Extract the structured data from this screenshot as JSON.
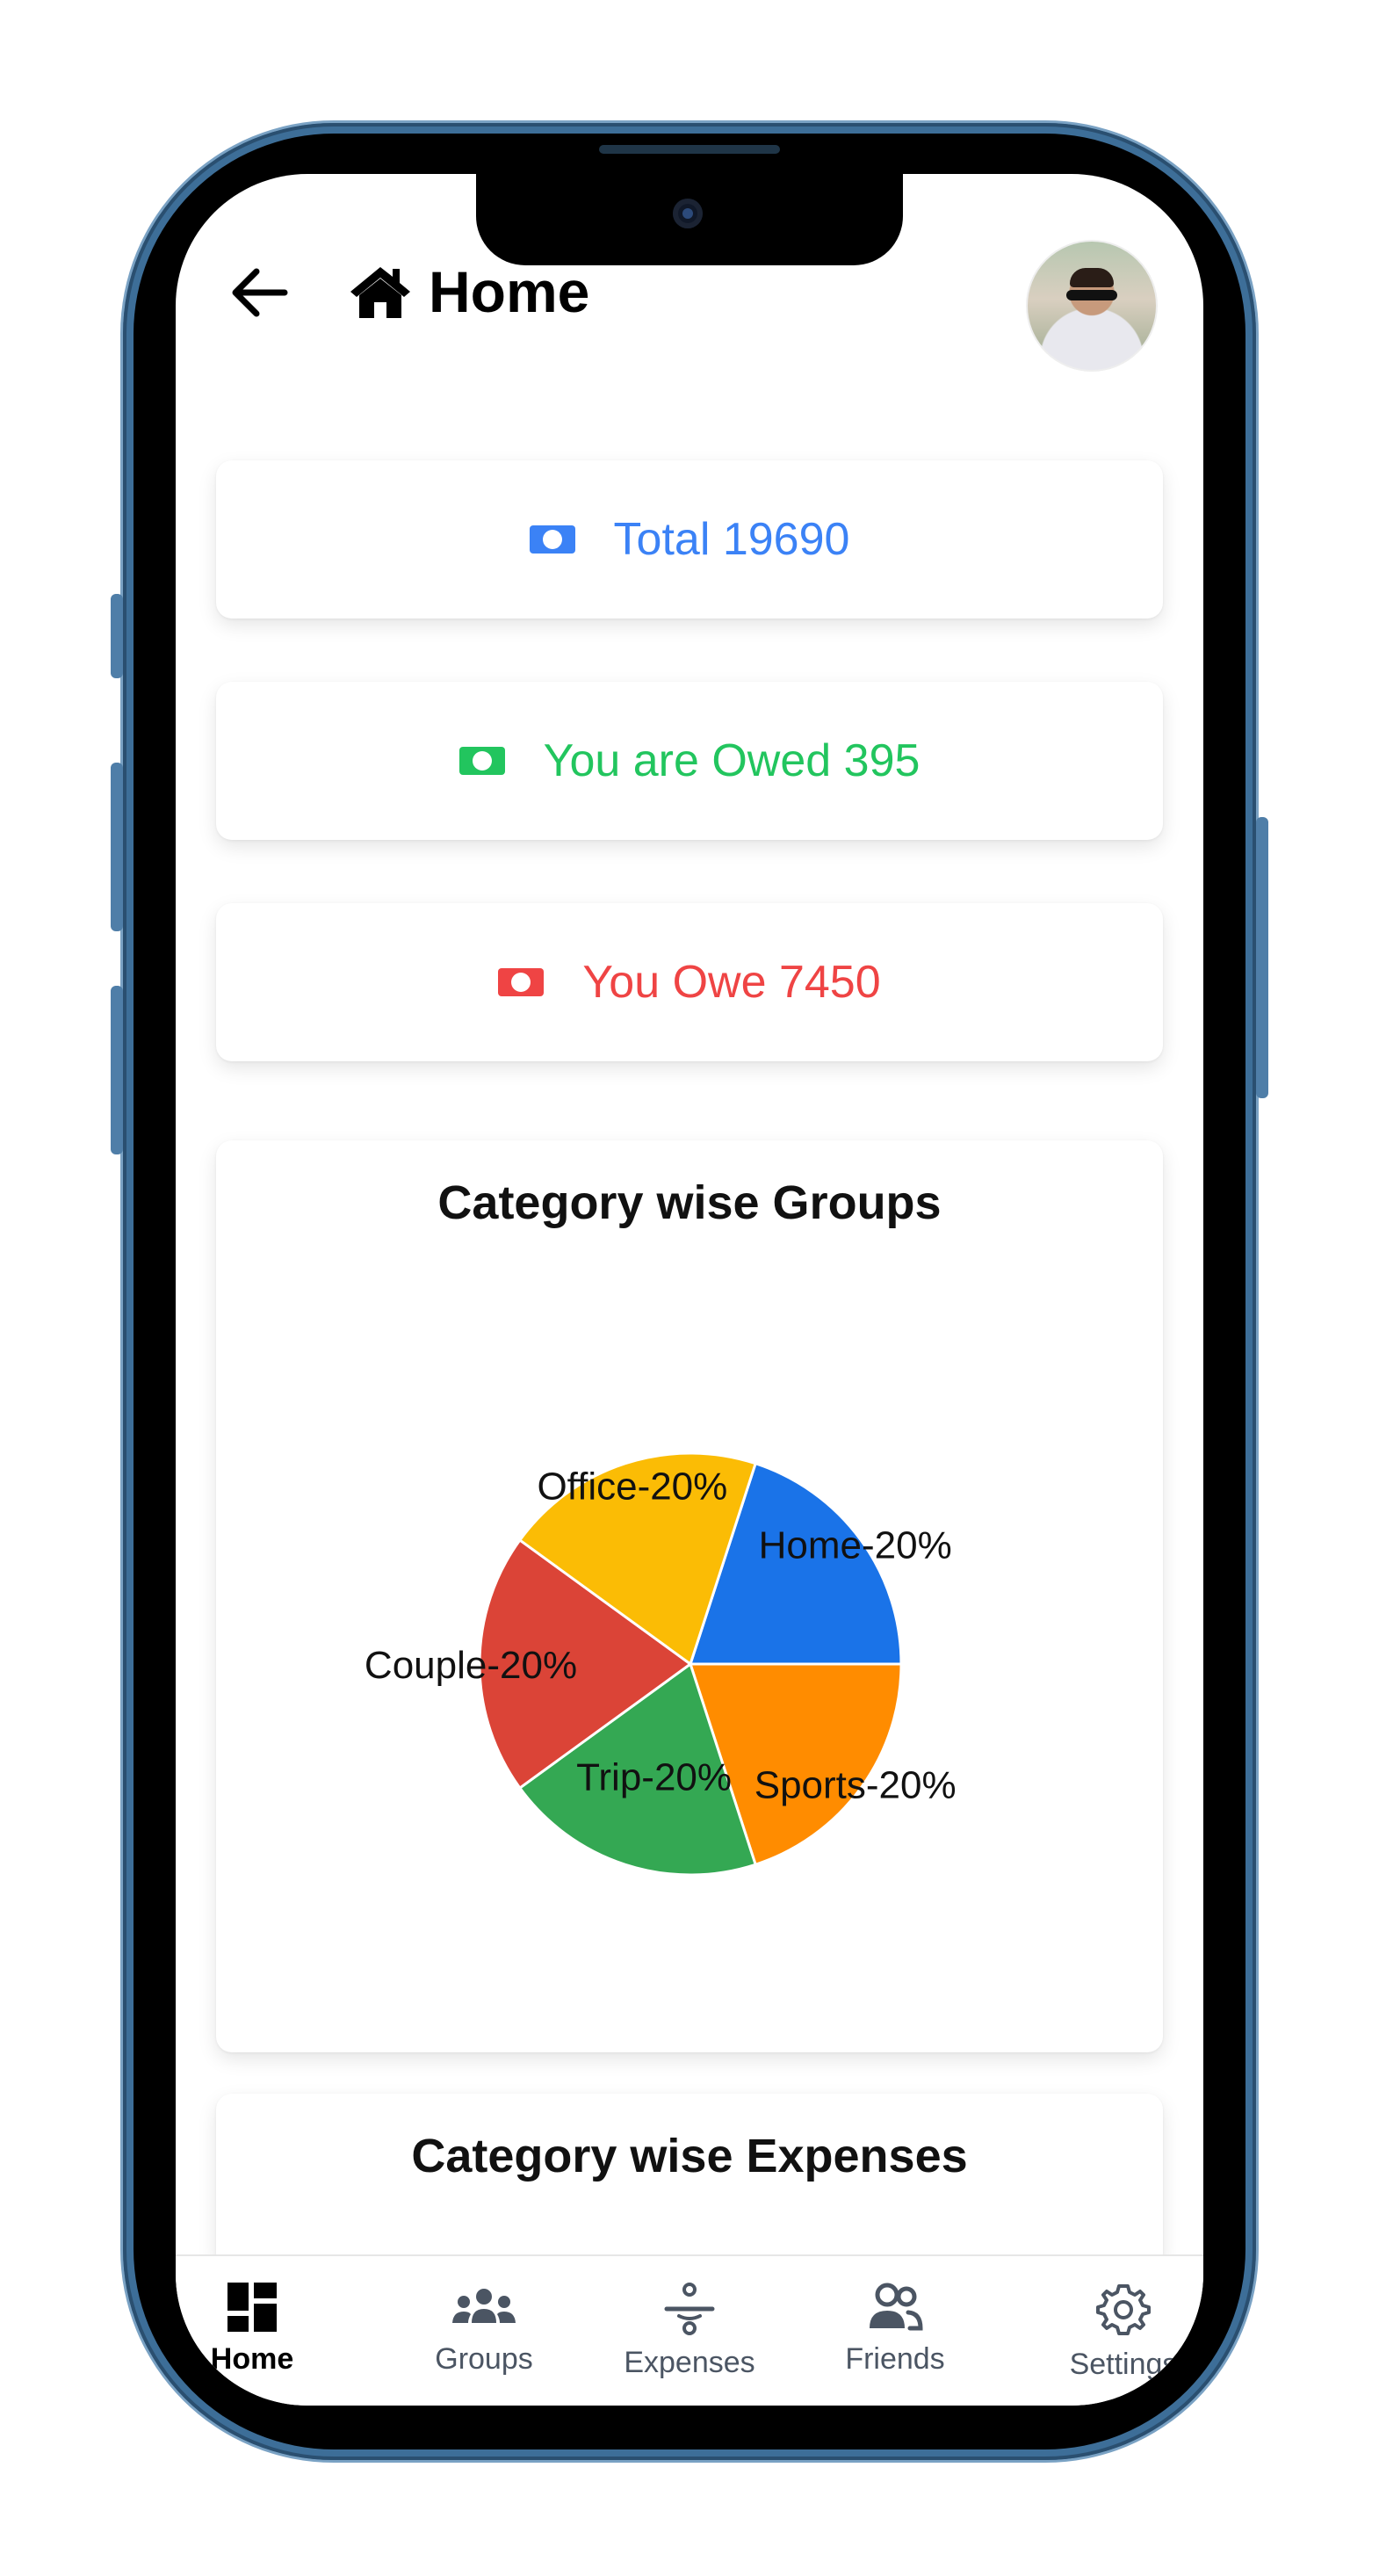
{
  "header": {
    "title": "Home",
    "back_icon": "arrow-left-icon",
    "home_icon": "house-icon",
    "avatar": "user-avatar"
  },
  "summary": {
    "total": {
      "label": "Total 19690",
      "value": 19690,
      "color": "#3b82f6",
      "icon": "money-bill-icon"
    },
    "owed": {
      "label": "You are Owed 395",
      "value": 395,
      "color": "#22c55e",
      "icon": "money-bill-icon"
    },
    "owe": {
      "label": "You Owe 7450",
      "value": 7450,
      "color": "#ef4444",
      "icon": "money-bill-icon"
    }
  },
  "groups_chart": {
    "title": "Category wise Groups"
  },
  "expenses_chart": {
    "title": "Category wise Expenses"
  },
  "chart_data": [
    {
      "type": "pie",
      "title": "Category wise Groups",
      "categories": [
        "Home",
        "Sports",
        "Trip",
        "Couple",
        "Office"
      ],
      "values": [
        20,
        20,
        20,
        20,
        20
      ],
      "labels": [
        "Home-20%",
        "Sports-20%",
        "Trip-20%",
        "Couple-20%",
        "Office-20%"
      ],
      "colors": [
        "#1a73e8",
        "#ff8c00",
        "#34a853",
        "#db4437",
        "#fbbc05"
      ]
    }
  ],
  "bottom_nav": [
    {
      "label": "Home",
      "icon": "dashboard-icon",
      "active": true
    },
    {
      "label": "Groups",
      "icon": "users-group-icon",
      "active": false
    },
    {
      "label": "Expenses",
      "icon": "divide-icon",
      "active": false
    },
    {
      "label": "Friends",
      "icon": "friends-icon",
      "active": false
    },
    {
      "label": "Settings",
      "icon": "gear-icon",
      "active": false
    }
  ]
}
